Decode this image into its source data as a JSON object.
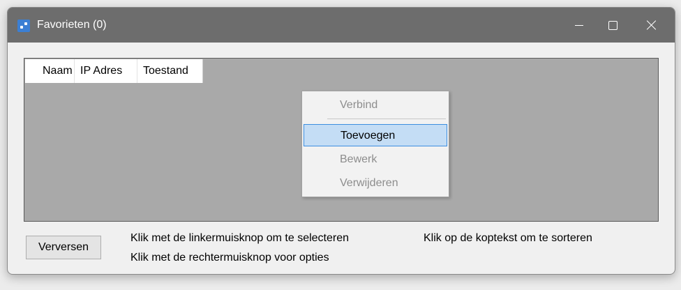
{
  "window": {
    "title": "Favorieten (0)",
    "icon": "favorites-app-icon",
    "controls": [
      "minimize",
      "maximize",
      "close"
    ]
  },
  "list": {
    "columns": [
      "Naam",
      "IP Adres",
      "Toestand"
    ],
    "background": "#a9a9a9"
  },
  "context_menu": {
    "items": [
      {
        "label": "Verbind",
        "enabled": false
      },
      {
        "label": "Toevoegen",
        "enabled": true,
        "highlighted": true
      },
      {
        "label": "Bewerk",
        "enabled": false
      },
      {
        "label": "Verwijderen",
        "enabled": false
      }
    ],
    "highlight_color": "#c4ddf5"
  },
  "footer": {
    "refresh_label": "Verversen",
    "hint_left_click": "Klik met de linkermuisknop om te selecteren",
    "hint_right_click": "Klik met de rechtermuisknop voor opties",
    "hint_sort": "Klik op de koptekst om te sorteren"
  }
}
